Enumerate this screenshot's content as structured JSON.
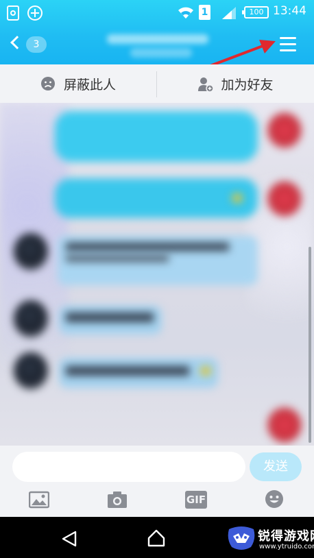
{
  "status_bar": {
    "sim_label": "1",
    "battery": "100",
    "time": "13:44"
  },
  "header": {
    "back_count": "3"
  },
  "actions": {
    "block_label": "屏蔽此人",
    "add_friend_label": "加为好友"
  },
  "input": {
    "placeholder": "",
    "send_label": "发送"
  },
  "toolbar": {
    "gif_label": "GIF"
  },
  "watermark": {
    "brand": "锐得游戏网",
    "url": "www.ytruido.com"
  },
  "colors": {
    "header_blue": "#20bdf3",
    "bubble_blue": "#38c8ee",
    "annotation_arrow": "#e0282e"
  },
  "icons": [
    "back-icon",
    "menu-icon",
    "block-icon",
    "add-friend-icon",
    "image-icon",
    "camera-icon",
    "gif-icon",
    "emoji-icon",
    "nav-back-icon",
    "nav-home-icon"
  ]
}
